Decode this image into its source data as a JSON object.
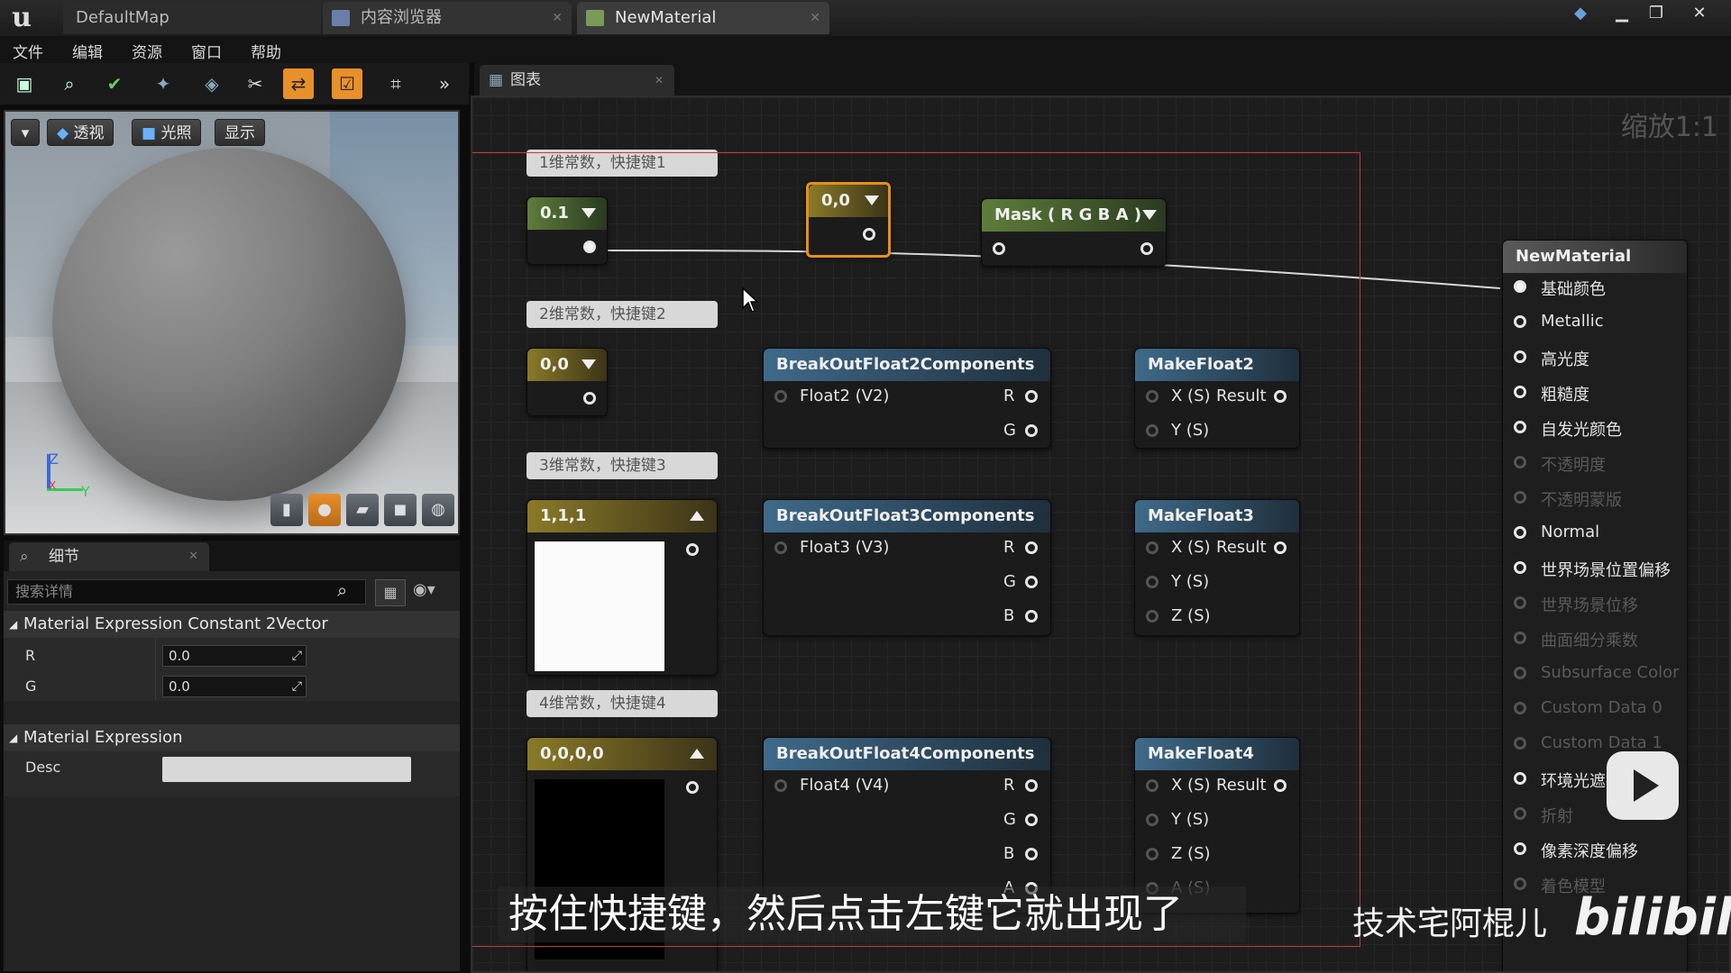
{
  "titlebar": {
    "tabs": [
      {
        "label": "DefaultMap"
      },
      {
        "label": "内容浏览器"
      },
      {
        "label": "NewMaterial"
      }
    ]
  },
  "menu": [
    "文件",
    "编辑",
    "资源",
    "窗口",
    "帮助"
  ],
  "viewport": {
    "buttons": {
      "perspective": "透视",
      "lighting": "光照",
      "show": "显示"
    },
    "axis": {
      "z": "Z",
      "x": "X",
      "y": "Y"
    }
  },
  "details": {
    "tab_label": "细节",
    "search_placeholder": "搜索详情",
    "section1": "Material Expression Constant 2Vector",
    "props": [
      {
        "label": "R",
        "value": "0.0"
      },
      {
        "label": "G",
        "value": "0.0"
      }
    ],
    "section2": "Material Expression",
    "desc_label": "Desc"
  },
  "graph": {
    "tab_label": "图表",
    "zoom": "缩放1:1",
    "comments": [
      "1维常数，快捷键1",
      "2维常数，快捷键2",
      "3维常数，快捷键3",
      "4维常数，快捷键4"
    ],
    "nodes": {
      "c1": "0.1",
      "c2": "0,0",
      "c3": "1,1,1",
      "c4": "0,0,0,0",
      "selected": "0,0",
      "mask": "Mask ( R G B A )",
      "break2": {
        "title": "BreakOutFloat2Components",
        "in": "Float2 (V2)",
        "outs": [
          "R",
          "G"
        ]
      },
      "break3": {
        "title": "BreakOutFloat3Components",
        "in": "Float3 (V3)",
        "outs": [
          "R",
          "G",
          "B"
        ]
      },
      "break4": {
        "title": "BreakOutFloat4Components",
        "in": "Float4 (V4)",
        "outs": [
          "R",
          "G",
          "B",
          "A"
        ]
      },
      "make2": {
        "title": "MakeFloat2",
        "ins": [
          "X (S)",
          "Y (S)"
        ],
        "out": "Result"
      },
      "make3": {
        "title": "MakeFloat3",
        "ins": [
          "X (S)",
          "Y (S)",
          "Z (S)"
        ],
        "out": "Result"
      },
      "make4": {
        "title": "MakeFloat4",
        "ins": [
          "X (S)",
          "Y (S)",
          "Z (S)",
          "A (S)"
        ],
        "out": "Result"
      }
    },
    "material": {
      "title": "NewMaterial",
      "inputs": [
        {
          "label": "基础颜色",
          "active": true
        },
        {
          "label": "Metallic",
          "active": true
        },
        {
          "label": "高光度",
          "active": true
        },
        {
          "label": "粗糙度",
          "active": true
        },
        {
          "label": "自发光颜色",
          "active": true
        },
        {
          "label": "不透明度",
          "active": false
        },
        {
          "label": "不透明蒙版",
          "active": false
        },
        {
          "label": "Normal",
          "active": true
        },
        {
          "label": "世界场景位置偏移",
          "active": true
        },
        {
          "label": "世界场景位移",
          "active": false
        },
        {
          "label": "曲面细分乘数",
          "active": false
        },
        {
          "label": "Subsurface Color",
          "active": false
        },
        {
          "label": "Custom Data 0",
          "active": false
        },
        {
          "label": "Custom Data 1",
          "active": false
        },
        {
          "label": "环境光遮挡",
          "active": true
        },
        {
          "label": "折射",
          "active": false
        },
        {
          "label": "像素深度偏移",
          "active": true
        },
        {
          "label": "着色模型",
          "active": false
        }
      ]
    }
  },
  "overlay": {
    "subtitle": "按住快捷键，然后点击左键它就出现了",
    "uploader": "技术宅阿棍儿",
    "logo": "bilibili"
  }
}
